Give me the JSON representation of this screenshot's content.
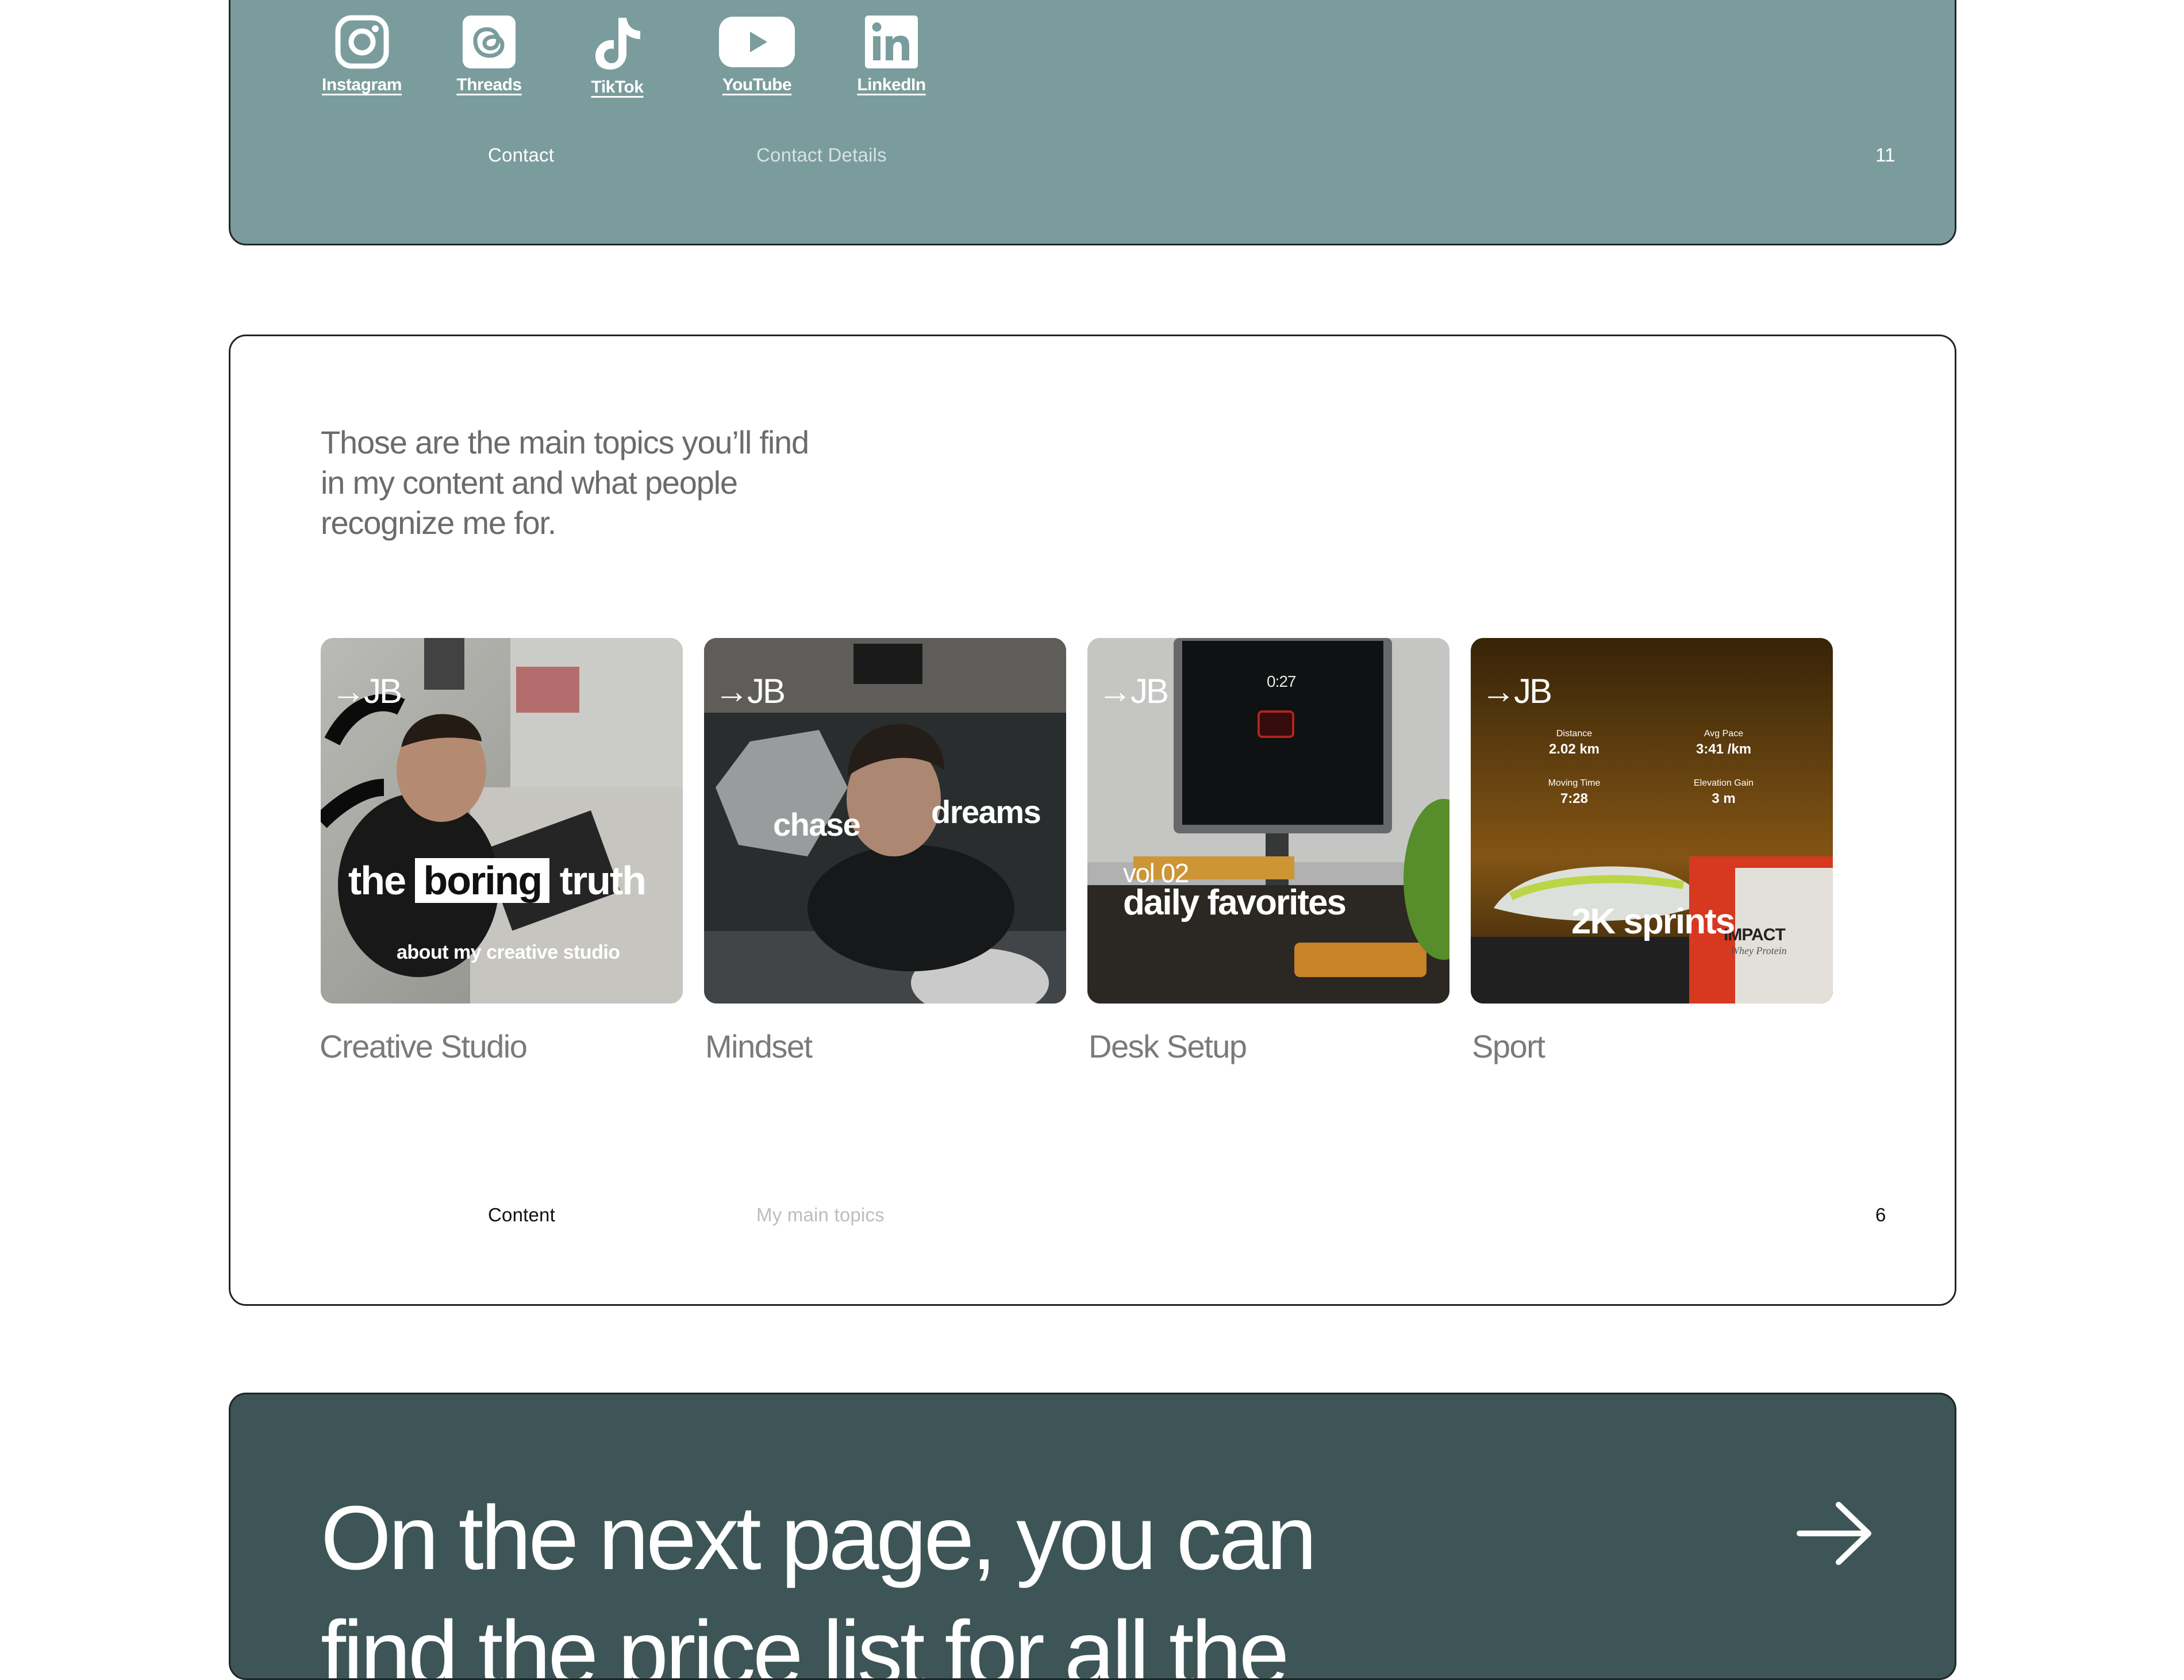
{
  "contact_panel": {
    "socials": [
      {
        "name": "Instagram",
        "icon": "instagram-icon"
      },
      {
        "name": "Threads",
        "icon": "threads-icon"
      },
      {
        "name": "TikTok",
        "icon": "tiktok-icon"
      },
      {
        "name": "YouTube",
        "icon": "youtube-icon"
      },
      {
        "name": "LinkedIn",
        "icon": "linkedin-icon"
      }
    ],
    "footer": {
      "section": "Contact",
      "subsection": "Contact Details",
      "page_number": "11"
    }
  },
  "content_panel": {
    "intro_lines": [
      "Those are the main topics you’ll find",
      "in my content and what people",
      "recognize me for."
    ],
    "cards": [
      {
        "title": "Creative Studio",
        "logo": "→JB",
        "overlay": {
          "word1": "the",
          "word2": "boring",
          "word3": "truth",
          "caption": "about my creative studio"
        }
      },
      {
        "title": "Mindset",
        "logo": "→JB",
        "overlay": {
          "left": "chase",
          "right": "dreams"
        }
      },
      {
        "title": "Desk Setup",
        "logo": "→JB",
        "overlay": {
          "vol": "vol 02",
          "main": "daily favorites",
          "screen_time": "0:27"
        }
      },
      {
        "title": "Sport",
        "logo": "→JB",
        "overlay": {
          "main": "2K sprints",
          "stats": [
            {
              "label": "Distance",
              "value": "2.02 km"
            },
            {
              "label": "Avg Pace",
              "value": "3:41 /km"
            },
            {
              "label": "Moving Time",
              "value": "7:28"
            },
            {
              "label": "Elevation Gain",
              "value": "3 m"
            }
          ],
          "brand": "IMPACT",
          "brand_sub": "Whey Protein"
        }
      }
    ],
    "footer": {
      "section": "Content",
      "subsection": "My main topics",
      "page_number": "6"
    }
  },
  "next_panel": {
    "lines": [
      "On the next page, you can",
      "find the price list for all the"
    ],
    "arrow_icon": "arrow-right-icon"
  },
  "colors": {
    "contact_bg": "#7b9c9d",
    "next_bg": "#3d5556",
    "text_gray": "#6b6b6b"
  }
}
